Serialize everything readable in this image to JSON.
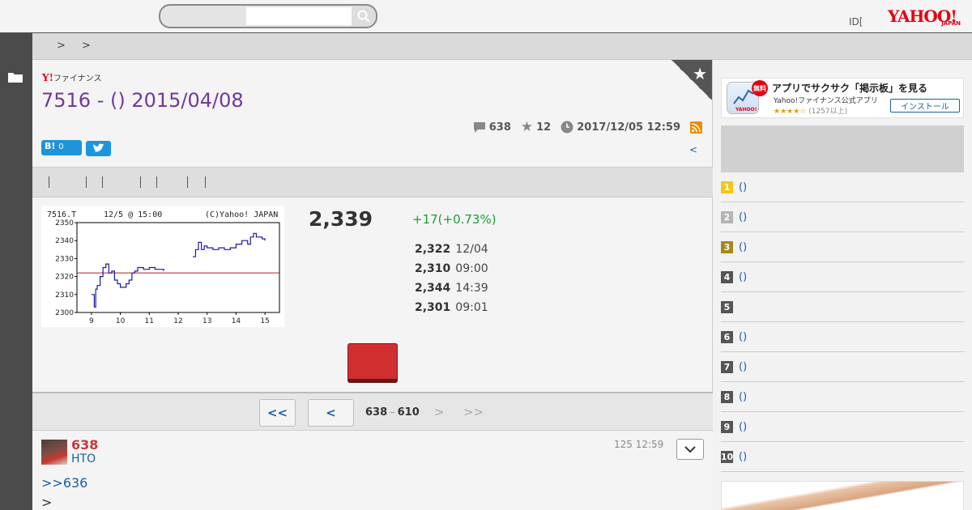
{
  "header": {
    "search_placeholder": "",
    "id_link": "ID[",
    "logo_text": "YAHOO!",
    "logo_sub": "JAPAN"
  },
  "breadcrumb": [
    ">",
    ">"
  ],
  "board": {
    "finance_logo_mark": "Y!",
    "finance_logo_text": "ファイナンス",
    "title": "7516 - () 2015/04/08",
    "comment_count": "638",
    "star_count": "12",
    "updated": "2017/12/05 12:59",
    "hatena_label": "B!",
    "hatena_count": "0",
    "prev_link": "<"
  },
  "quote": {
    "price": "2,339",
    "change": "+17(+0.73%)",
    "stats": [
      {
        "value": "2,322",
        "label": "12/04"
      },
      {
        "value": "2,310",
        "label": "09:00"
      },
      {
        "value": "2,344",
        "label": "14:39"
      },
      {
        "value": "2,301",
        "label": "09:01"
      }
    ]
  },
  "chart_data": {
    "type": "line",
    "title": "7516.T",
    "subtitle": "12/5 @ 15:00",
    "credit": "(C)Yahoo! JAPAN",
    "x_ticks": [
      "9",
      "10",
      "11",
      "12",
      "13",
      "14",
      "15"
    ],
    "y_ticks": [
      "2350",
      "2340",
      "2330",
      "2320",
      "2310",
      "2300"
    ],
    "ylim": [
      2300,
      2350
    ],
    "reference_line": 2322,
    "series": [
      {
        "x": [
          9.0,
          9.1,
          9.15,
          9.2,
          9.3,
          9.4,
          9.5,
          9.6,
          9.7,
          9.8,
          9.9,
          10.0,
          10.1,
          10.2,
          10.3,
          10.4,
          10.5,
          10.6,
          10.7,
          10.8,
          10.9,
          11.0,
          11.2,
          11.4,
          11.5
        ],
        "values": [
          2310,
          2303,
          2313,
          2315,
          2320,
          2325,
          2327,
          2322,
          2323,
          2318,
          2316,
          2314,
          2314,
          2316,
          2318,
          2322,
          2323,
          2325,
          2325,
          2324,
          2324,
          2325,
          2324,
          2324,
          2323
        ]
      },
      {
        "x": [
          12.5,
          12.6,
          12.7,
          12.8,
          12.9,
          13.0,
          13.2,
          13.4,
          13.6,
          13.8,
          14.0,
          14.2,
          14.4,
          14.5,
          14.6,
          14.7,
          14.8,
          14.9,
          15.0
        ],
        "values": [
          2331,
          2335,
          2339,
          2335,
          2337,
          2336,
          2335,
          2336,
          2335,
          2336,
          2338,
          2340,
          2338,
          2342,
          2344,
          2342,
          2342,
          2341,
          2340
        ]
      }
    ]
  },
  "pager": {
    "first": "<<",
    "prev": "<",
    "from": "638",
    "dash": "–",
    "to": "610",
    "next": ">",
    "last": ">>"
  },
  "comment": {
    "number": "638",
    "user": "HTO",
    "time": "125 12:59",
    "reply_to": ">>636",
    "body": ">"
  },
  "sidebar": {
    "app_badge": "無料",
    "app_title": "アプリでサクサク「掲示板」を見る",
    "app_sub": "Yahoo!ファイナンス公式アプリ",
    "app_stars": "★★★★☆",
    "app_reviews": "(1257以上)",
    "app_install": "インストール",
    "ranking": [
      {
        "rank": "1",
        "label": "()",
        "color": "#f5c518"
      },
      {
        "rank": "2",
        "label": "()",
        "color": "#b4b4b4"
      },
      {
        "rank": "3",
        "label": "()",
        "color": "#a8861c"
      },
      {
        "rank": "4",
        "label": "()",
        "color": "#555555"
      },
      {
        "rank": "5",
        "label": "",
        "color": "#555555"
      },
      {
        "rank": "6",
        "label": "()",
        "color": "#555555"
      },
      {
        "rank": "7",
        "label": "()",
        "color": "#555555"
      },
      {
        "rank": "8",
        "label": "()",
        "color": "#555555"
      },
      {
        "rank": "9",
        "label": "()",
        "color": "#555555"
      },
      {
        "rank": "10",
        "label": "()",
        "color": "#555555"
      }
    ]
  }
}
